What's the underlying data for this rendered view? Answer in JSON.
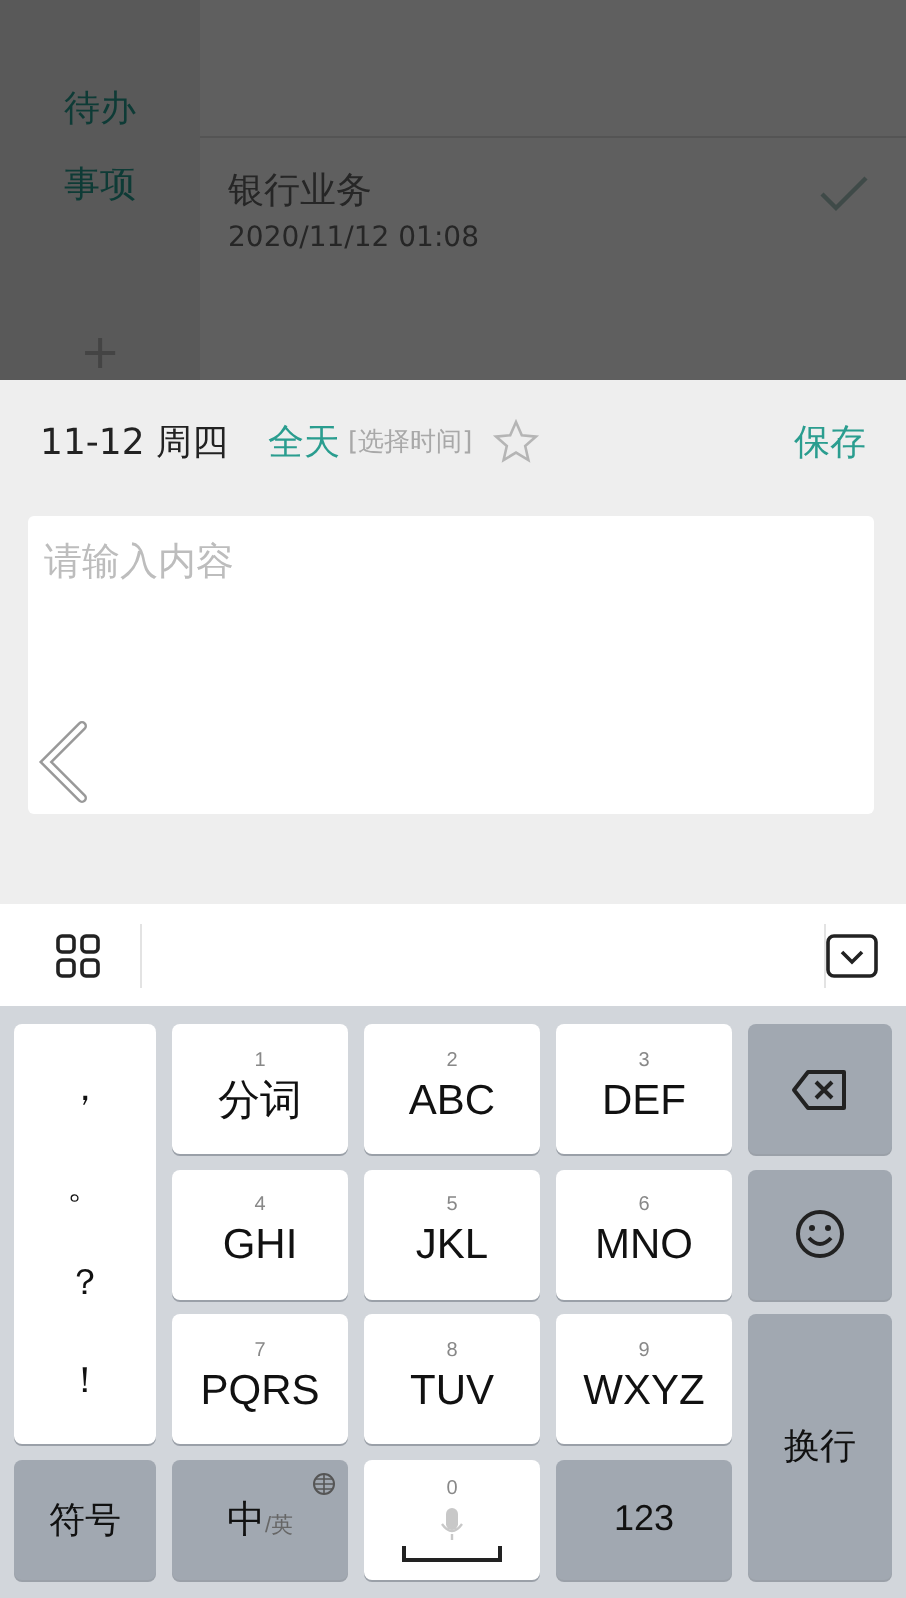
{
  "background": {
    "sidebar": {
      "items": [
        {
          "label": "待办"
        },
        {
          "label": "事项"
        }
      ],
      "add": "+"
    },
    "task": {
      "title": "银行业务",
      "time": "2020/11/12 01:08"
    }
  },
  "editor": {
    "date": "11-12 周四",
    "all_day": "全天",
    "time_picker": "[选择时间]",
    "starred": false,
    "save": "保存",
    "content": {
      "placeholder": "请输入内容"
    }
  },
  "keyboard": {
    "keys": [
      {
        "kind": "punct",
        "chars": [
          "，",
          "。",
          "？",
          "！"
        ]
      },
      {
        "kind": "t9",
        "digit": "1",
        "label": "分词"
      },
      {
        "kind": "t9",
        "digit": "2",
        "label": "ABC"
      },
      {
        "kind": "t9",
        "digit": "3",
        "label": "DEF"
      },
      {
        "kind": "backspace"
      },
      {
        "kind": "t9",
        "digit": "4",
        "label": "GHI"
      },
      {
        "kind": "t9",
        "digit": "5",
        "label": "JKL"
      },
      {
        "kind": "t9",
        "digit": "6",
        "label": "MNO"
      },
      {
        "kind": "emoji"
      },
      {
        "kind": "t9",
        "digit": "7",
        "label": "PQRS"
      },
      {
        "kind": "t9",
        "digit": "8",
        "label": "TUV"
      },
      {
        "kind": "t9",
        "digit": "9",
        "label": "WXYZ"
      },
      {
        "kind": "enter",
        "label": "换行"
      },
      {
        "kind": "dark",
        "label": "符号"
      },
      {
        "kind": "lang",
        "label": "中",
        "sub": "/英"
      },
      {
        "kind": "space",
        "digit": "0"
      },
      {
        "kind": "dark",
        "label": "123"
      }
    ]
  }
}
